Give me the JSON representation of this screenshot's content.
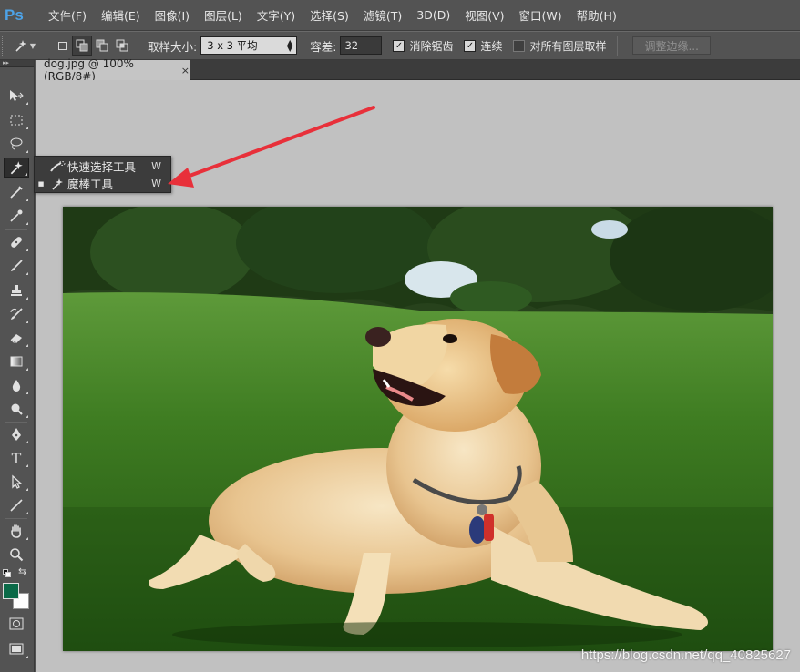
{
  "app": {
    "logo": "Ps"
  },
  "menu": [
    "文件(F)",
    "编辑(E)",
    "图像(I)",
    "图层(L)",
    "文字(Y)",
    "选择(S)",
    "滤镜(T)",
    "3D(D)",
    "视图(V)",
    "窗口(W)",
    "帮助(H)"
  ],
  "options": {
    "sample_size_label": "取样大小:",
    "sample_size_value": "3 x 3 平均",
    "tolerance_label": "容差:",
    "tolerance_value": "32",
    "antialias_label": "消除锯齿",
    "antialias_checked": true,
    "contiguous_label": "连续",
    "contiguous_checked": true,
    "all_layers_label": "对所有图层取样",
    "all_layers_checked": false,
    "refine_edge_label": "调整边缘..."
  },
  "toolbar_header": "▸▸",
  "tools": [
    "move-tool",
    "marquee-tool",
    "lasso-tool",
    "magic-wand-tool",
    "crop-tool",
    "eyedropper-tool",
    "healing-brush-tool",
    "brush-tool",
    "clone-stamp-tool",
    "history-brush-tool",
    "eraser-tool",
    "gradient-tool",
    "blur-tool",
    "dodge-tool",
    "pen-tool",
    "type-tool",
    "path-selection-tool",
    "line-tool",
    "hand-tool",
    "zoom-tool"
  ],
  "document": {
    "tab_title": "dog.jpg @ 100%(RGB/8#)",
    "close": "×"
  },
  "flyout": {
    "items": [
      {
        "label": "快速选择工具",
        "shortcut": "W",
        "active": false,
        "icon": "quick-selection-icon"
      },
      {
        "label": "魔棒工具",
        "shortcut": "W",
        "active": true,
        "icon": "magic-wand-icon"
      }
    ],
    "bullet": "■"
  },
  "colors": {
    "foreground": "#0b6a48",
    "background": "#ffffff",
    "annotation_arrow": "#e8303a"
  },
  "type_tool_glyph": "T",
  "watermark": "https://blog.csdn.net/qq_40825627"
}
